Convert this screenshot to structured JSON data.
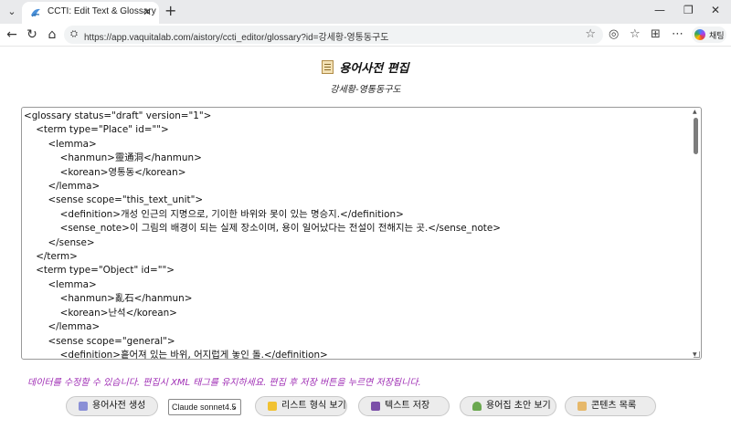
{
  "browser": {
    "tab_title": "CCTI: Edit Text & Glossary",
    "new_tab_symbol": "+",
    "url": "https://app.vaquitalab.com/aistory/ccti_editor/glossary?id=강세황-영통동구도",
    "chat_label": "채팅"
  },
  "page": {
    "title": "용어사전 편집",
    "subtitle": "강세황-영통동구도",
    "editor_content": "<glossary status=\"draft\" version=\"1\">\n\t<term type=\"Place\" id=\"\">\n\t\t<lemma>\n\t\t\t<hanmun>靈通洞</hanmun>\n\t\t\t<korean>영통동</korean>\n\t\t</lemma>\n\t\t<sense scope=\"this_text_unit\">\n\t\t\t<definition>개성 인근의 지명으로, 기이한 바위와 못이 있는 명승지.</definition>\n\t\t\t<sense_note>이 그림의 배경이 되는 실제 장소이며, 용이 일어났다는 전설이 전해지는 곳.</sense_note>\n\t\t</sense>\n\t</term>\n\t<term type=\"Object\" id=\"\">\n\t\t<lemma>\n\t\t\t<hanmun>亂石</hanmun>\n\t\t\t<korean>난석</korean>\n\t\t</lemma>\n\t\t<sense scope=\"general\">\n\t\t\t<definition>흩어져 있는 바위, 어지럽게 놓인 돌.</definition>",
    "notice": "데이터를 수정할 수 있습니다. 편집시 XML 태그를 유지하세요. 편집 후 저장 버튼을 누르면 저장됩니다."
  },
  "toolbar": {
    "generate_label": "용어사전 생성",
    "model_selected": "Claude sonnet4.5",
    "list_view_label": "리스트 형식 보기",
    "save_text_label": "텍스트 저장",
    "draft_view_label": "용어집 초안 보기",
    "contents_label": "콘텐츠 목록"
  },
  "colors": {
    "notice": "#a02fb5",
    "button_bg": "#ececec"
  },
  "icons": {
    "title": "memo-icon",
    "generate": "robot-icon",
    "list_view": "notepad-icon",
    "save": "floppy-disk-icon",
    "draft": "seedling-icon",
    "contents": "scroll-icon"
  }
}
